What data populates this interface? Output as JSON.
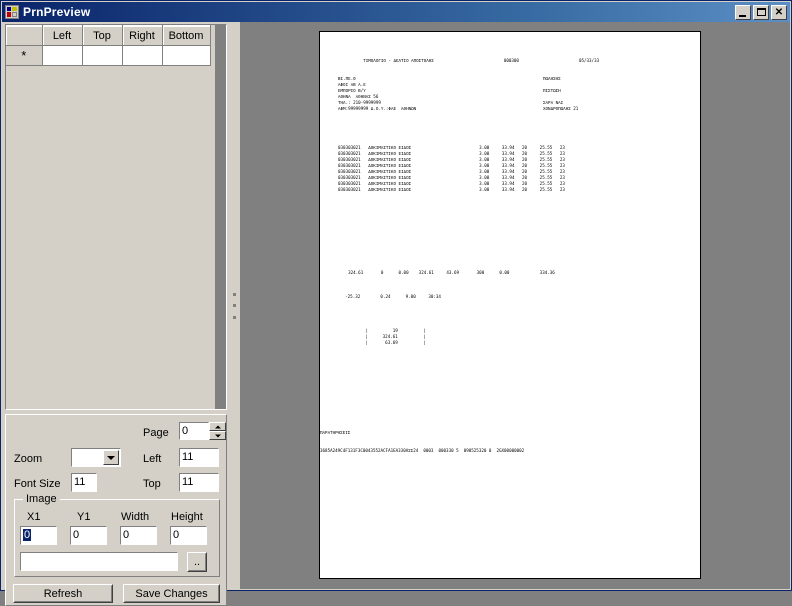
{
  "window": {
    "title": "PrnPreview",
    "icon": "app-icon",
    "buttons": {
      "minimize": "_",
      "maximize": "□",
      "close": "✕"
    }
  },
  "grid": {
    "columns": [
      "",
      "Left",
      "Top",
      "Right",
      "Bottom"
    ],
    "rows": [
      {
        "header": "*",
        "cells": [
          "",
          "",
          "",
          ""
        ]
      }
    ]
  },
  "controls": {
    "page_label": "Page",
    "page_value": "0",
    "zoom_label": "Zoom",
    "zoom_value": "",
    "left_label": "Left",
    "left_value": "11",
    "fontsize_label": "Font Size",
    "fontsize_value": "11",
    "top_label": "Top",
    "top_value": "11",
    "image_group_label": "Image",
    "x1_label": "X1",
    "x1_value": "0",
    "y1_label": "Y1",
    "y1_value": "0",
    "width_label": "Width",
    "width_value": "0",
    "height_label": "Height",
    "height_value": "0",
    "path_value": "",
    "browse_label": "..",
    "refresh_label": "Refresh",
    "save_label": "Save Changes"
  },
  "document": {
    "header_title": "ΤΙΜΟΛΟΓΙΟ - ΔΕΛΤΙΟ ΑΠΟΣΤΟΛΗΣ",
    "header_number": "000300",
    "header_date": "05/33/33",
    "address_left": "ΒΙ.ΠΕ.Θ\nΑΦΟΙ ΑΒ Α.Ε\nΕΜΠΟΡΙΟ Β/Υ\nΑΘΗΝΑ  ΑΘΗΝΑΣ 56\nΤΗΛ.: 210-9999999\nΑΦΜ:99999999 Δ.Ο.Υ.:ΦΑΕ  ΑΘΗΝΩΝ",
    "address_right": "ΠΩΛΗΣΗΣ\n\nΠΙΣΤΩΣΗ\n\nΣΑΡΑ ΝΑΙ\nΧΟΝΔΡΟΠΩΛΗΣ 21",
    "table_rows": [
      {
        "code": "030303021",
        "desc": "ΔΟΚΙΜΑΣΤΙΚΟ ΕΙΔΟΣ",
        "qty": "3.00",
        "price": "33.94",
        "disc": "20",
        "net": "25.55",
        "vat": "23"
      },
      {
        "code": "030303021",
        "desc": "ΔΟΚΙΜΑΣΤΙΚΟ ΕΙΔΟΣ",
        "qty": "3.00",
        "price": "33.94",
        "disc": "20",
        "net": "25.55",
        "vat": "23"
      },
      {
        "code": "030303021",
        "desc": "ΔΟΚΙΜΑΣΤΙΚΟ ΕΙΔΟΣ",
        "qty": "3.00",
        "price": "33.94",
        "disc": "20",
        "net": "25.55",
        "vat": "23"
      },
      {
        "code": "030303021",
        "desc": "ΔΟΚΙΜΑΣΤΙΚΟ ΕΙΔΟΣ",
        "qty": "3.00",
        "price": "33.94",
        "disc": "20",
        "net": "25.55",
        "vat": "23"
      },
      {
        "code": "030303021",
        "desc": "ΔΟΚΙΜΑΣΤΙΚΟ ΕΙΔΟΣ",
        "qty": "3.00",
        "price": "33.94",
        "disc": "20",
        "net": "25.55",
        "vat": "23"
      },
      {
        "code": "030303021",
        "desc": "ΔΟΚΙΜΑΣΤΙΚΟ ΕΙΔΟΣ",
        "qty": "3.00",
        "price": "33.94",
        "disc": "20",
        "net": "25.55",
        "vat": "23"
      },
      {
        "code": "030303021",
        "desc": "ΔΟΚΙΜΑΣΤΙΚΟ ΕΙΔΟΣ",
        "qty": "3.00",
        "price": "33.94",
        "disc": "20",
        "net": "25.55",
        "vat": "23"
      },
      {
        "code": "030303021",
        "desc": "ΔΟΚΙΜΑΣΤΙΚΟ ΕΙΔΟΣ",
        "qty": "3.00",
        "price": "33.94",
        "disc": "20",
        "net": "25.55",
        "vat": "23"
      }
    ],
    "totals_row": [
      "324.61",
      "0",
      "0.00",
      "324.61",
      "43.69",
      "300",
      "0.00",
      "334.36"
    ],
    "summary_row": [
      "-25.32",
      "0.24",
      "9.00",
      "30:34"
    ],
    "box_lines": [
      "19",
      "324.61",
      "63.69"
    ],
    "footer_label": "ΠΑΡΑΤΗΡΗΣΕΙΣ",
    "footer_code": "3685A249C4F131F3C0043552ACFA1EA330AΣΣ24  0003  000330 5  090525320 0  2GX00000002"
  }
}
